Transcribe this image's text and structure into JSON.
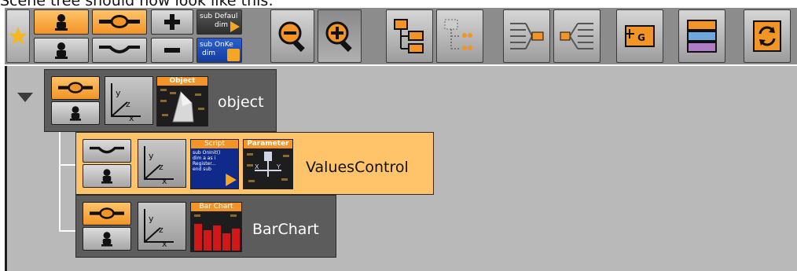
{
  "caption": "Scene tree should now look like this:",
  "toolbar": {
    "sub_default_line1": "sub Defaul",
    "sub_default_line2": "dim",
    "sub_onkey_line1": "sub OnKe",
    "sub_onkey_line2": "dim"
  },
  "tree": {
    "object": {
      "plugin_title": "Object",
      "label": "object"
    },
    "values_control": {
      "script_title": "Script",
      "script_text": "sub OnInit()\ndim a as i\nRegister...\nend sub",
      "param_title": "Parameter",
      "label": "ValuesControl"
    },
    "bar_chart": {
      "plugin_title": "Bar Chart",
      "label": "BarChart"
    }
  },
  "colors": {
    "accent": "#f29426",
    "selected": "#ffc46a",
    "panel": "#b9b9b9",
    "toolbar": "#8c8c8c"
  }
}
